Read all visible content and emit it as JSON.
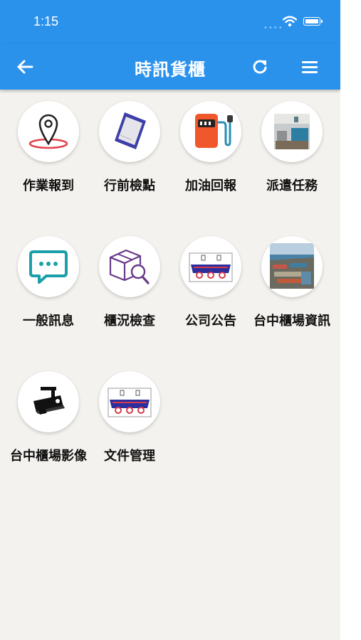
{
  "status_bar": {
    "time": "1:15"
  },
  "app_bar": {
    "title": "時訊貨櫃"
  },
  "tiles": [
    {
      "label": "作業報到",
      "icon": "location-pin-icon"
    },
    {
      "label": "行前檢點",
      "icon": "clipboard-icon"
    },
    {
      "label": "加油回報",
      "icon": "fuel-pump-icon"
    },
    {
      "label": "派遣任務",
      "icon": "dispatch-photo-icon"
    },
    {
      "label": "一般訊息",
      "icon": "chat-bubble-icon"
    },
    {
      "label": "櫃況檢查",
      "icon": "box-inspect-icon"
    },
    {
      "label": "公司公告",
      "icon": "company-truck-logo-icon"
    },
    {
      "label": "台中櫃場資訊",
      "icon": "port-photo-icon"
    },
    {
      "label": "台中櫃場影像",
      "icon": "cctv-camera-icon"
    },
    {
      "label": "文件管理",
      "icon": "company-truck-logo-icon"
    }
  ],
  "colors": {
    "primary": "#2b92ec",
    "background": "#f4f2ee"
  }
}
